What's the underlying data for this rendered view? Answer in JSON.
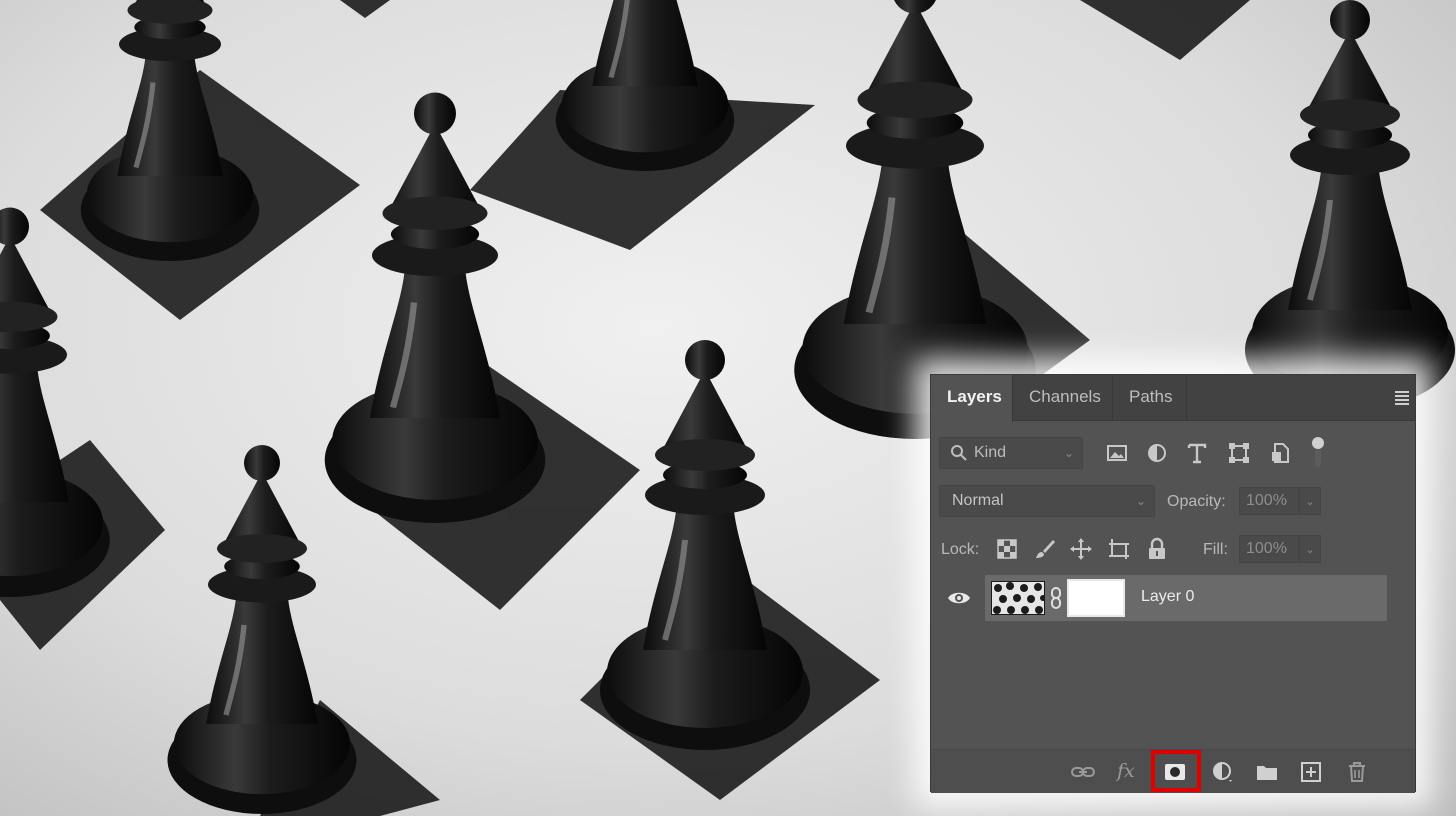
{
  "panel": {
    "tabs": [
      {
        "label": "Layers",
        "active": true
      },
      {
        "label": "Channels",
        "active": false
      },
      {
        "label": "Paths",
        "active": false
      }
    ],
    "menu_icon": "hamburger-icon",
    "filter": {
      "placeholder": "Kind"
    },
    "filter_icons": [
      "image-filter-icon",
      "adjustment-filter-icon",
      "type-filter-icon",
      "shape-filter-icon",
      "smart-object-filter-icon"
    ],
    "blend_mode": "Normal",
    "opacity": {
      "label": "Opacity:",
      "value": "100%"
    },
    "lock": {
      "label": "Lock:",
      "icons": [
        "lock-transparent-icon",
        "lock-image-icon",
        "lock-position-icon",
        "lock-artboard-icon",
        "lock-all-icon"
      ]
    },
    "fill": {
      "label": "Fill:",
      "value": "100%"
    },
    "layers": [
      {
        "name": "Layer 0",
        "visible": true,
        "has_mask": true
      }
    ],
    "bottom_icons": [
      "link-layers-icon",
      "fx-icon",
      "add-mask-icon",
      "adjustment-layer-icon",
      "group-folder-icon",
      "new-layer-icon",
      "trash-icon"
    ],
    "fx_label": "fx",
    "highlight_color": "#e00000"
  }
}
